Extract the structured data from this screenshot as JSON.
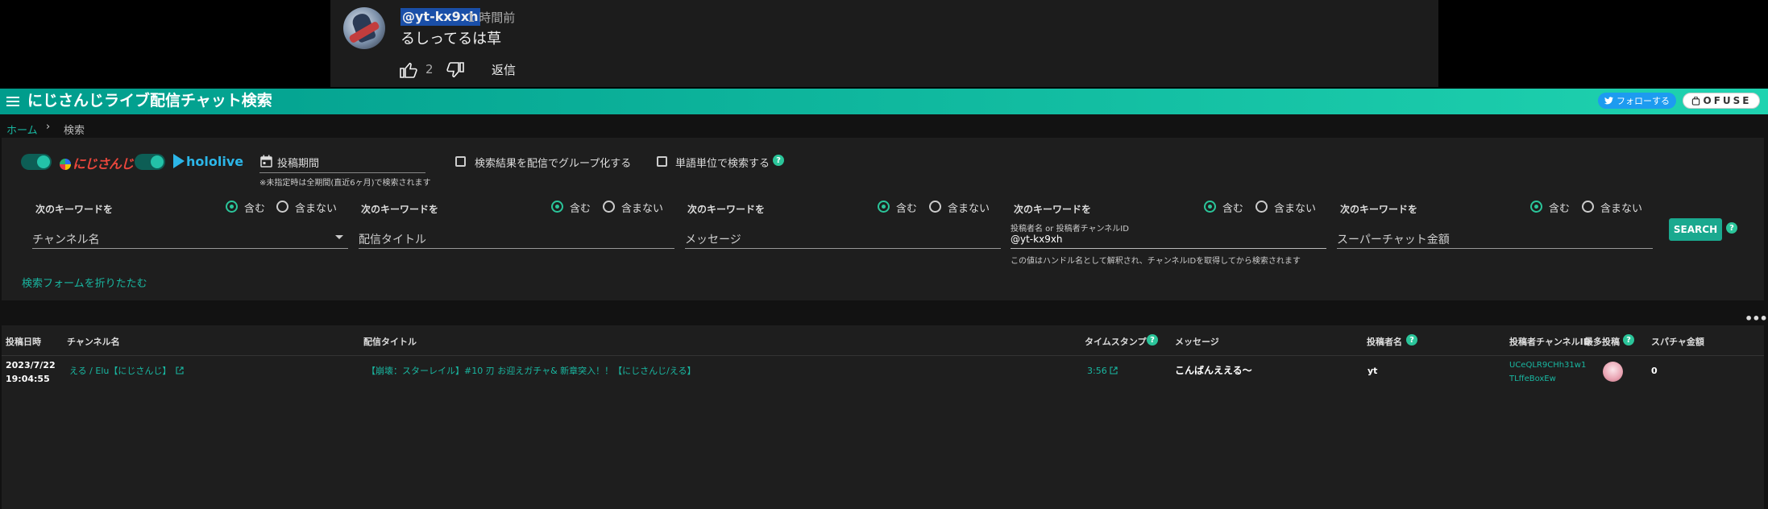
{
  "youtube_comment": {
    "handle": "@yt-kx9xh",
    "time": "1 時間前",
    "text": "るしってるは草",
    "like_count": "2",
    "reply_label": "返信"
  },
  "app": {
    "title": "にじさんじライブ配信チャット検索",
    "follow_label": "フォローする",
    "ofuse_label": "OFUSE"
  },
  "breadcrumb": {
    "home": "ホーム",
    "separator": "›",
    "current": "検索"
  },
  "filters": {
    "nijisanji_logo": "にじさんじ",
    "hololive_logo": "hololive",
    "period_label": "投稿期間",
    "period_hint": "※未指定時は全期間(直近6ヶ月)で検索されます",
    "group_by_stream_label": "検索結果を配信でグループ化する",
    "word_unit_label": "単語単位で検索する"
  },
  "keyword_groups": [
    {
      "label": "次のキーワードを",
      "include": "含む",
      "exclude": "含まない",
      "field_placeholder": "チャンネル名"
    },
    {
      "label": "次のキーワードを",
      "include": "含む",
      "exclude": "含まない",
      "field_placeholder": "配信タイトル"
    },
    {
      "label": "次のキーワードを",
      "include": "含む",
      "exclude": "含まない",
      "field_placeholder": "メッセージ"
    },
    {
      "label": "次のキーワードを",
      "include": "含む",
      "exclude": "含まない",
      "field_label": "投稿者名 or 投稿者チャンネルID",
      "field_value": "@yt-kx9xh",
      "field_hint": "この値はハンドル名として解釈され、チャンネルIDを取得してから検索されます"
    },
    {
      "label": "次のキーワードを",
      "include": "含む",
      "exclude": "含まない",
      "field_placeholder": "スーパーチャット金額"
    }
  ],
  "search_button": "SEARCH",
  "collapse_label": "検索フォームを折りたたむ",
  "more_label": "•••",
  "table": {
    "headers": {
      "posted_at": "投稿日時",
      "channel": "チャンネル名",
      "title": "配信タイトル",
      "timestamp": "タイムスタンプ",
      "message": "メッセージ",
      "author": "投稿者名",
      "author_channel_id": "投稿者チャンネルID",
      "latest_post": "最多投稿",
      "superchat": "スパチャ金額"
    },
    "rows": [
      {
        "date": "2023/7/22",
        "time": "19:04:55",
        "channel": "える / Elu【にじさんじ】",
        "title": "【崩壊：スターレイル】#10 刃 お迎えガチャ& 新章突入！！【にじさんじ/える】",
        "timestamp": "3:56",
        "message": "こんばんええる〜",
        "author": "yt",
        "author_id_line1": "UCeQLR9CHh31w1",
        "author_id_line2": "TLffeBoxEw",
        "superchat": "0"
      }
    ]
  },
  "colors": {
    "accent": "#19b7a1",
    "appbar_start": "#009c8c",
    "appbar_end": "#1fd3b0",
    "twitter": "#1d9bf0"
  }
}
